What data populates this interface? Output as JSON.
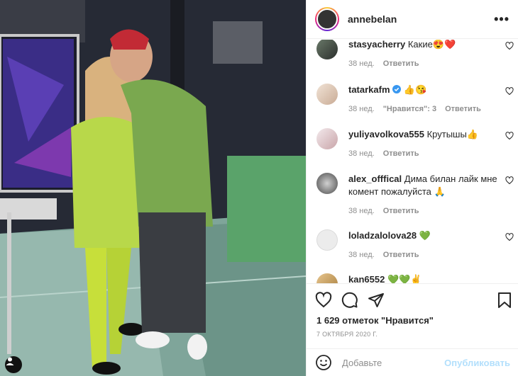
{
  "post": {
    "username": "annebelan",
    "likes": "1 629 отметок \"Нравится\"",
    "date": "7 ОКТЯБРЯ 2020 Г."
  },
  "comments": [
    {
      "user": "stasyacherry",
      "text": "Какие😍❤️",
      "time": "38 нед.",
      "likes": "",
      "reply": "Ответить"
    },
    {
      "user": "tatarkafm",
      "verified": true,
      "text": "👍😘",
      "time": "38 нед.",
      "likes": "\"Нравится\": 3",
      "reply": "Ответить"
    },
    {
      "user": "yuliyavolkova555",
      "text": "Крутышы👍",
      "time": "38 нед.",
      "likes": "",
      "reply": "Ответить"
    },
    {
      "user": "alex_offfical",
      "text": "Дима билан лайк мне комент пожалуйста 🙏",
      "time": "38 нед.",
      "likes": "",
      "reply": "Ответить"
    },
    {
      "user": "loladzalolova28",
      "text": "💚",
      "time": "38 нед.",
      "likes": "",
      "reply": "Ответить"
    },
    {
      "user": "kan6552",
      "text": "💚💚✌️",
      "time": "",
      "likes": "",
      "reply": ""
    }
  ],
  "composer": {
    "placeholder": "Добавьте",
    "post_label": "Опубликовать"
  },
  "colors": {
    "verified": "#3897f0",
    "post_disabled": "#b2dffc",
    "meta": "#8e8e8e"
  },
  "icons": [
    "more-icon",
    "heart-icon",
    "comment-icon",
    "share-icon",
    "bookmark-icon",
    "smile-icon",
    "user-tag-icon"
  ]
}
